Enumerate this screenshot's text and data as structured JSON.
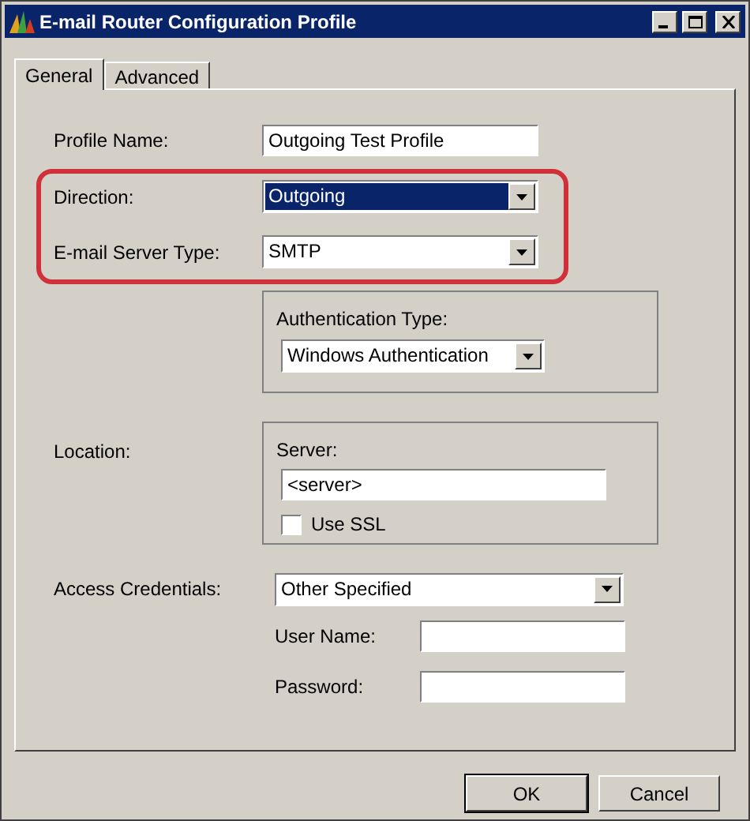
{
  "window": {
    "title": "E-mail Router Configuration Profile"
  },
  "tabs": [
    {
      "label": "General",
      "selected": true
    },
    {
      "label": "Advanced",
      "selected": false
    }
  ],
  "profile_name": {
    "label": "Profile Name:",
    "value": "Outgoing Test Profile"
  },
  "direction": {
    "label": "Direction:",
    "value": "Outgoing",
    "focused": true
  },
  "server_type": {
    "label": "E-mail Server Type:",
    "value": "SMTP",
    "focused": false
  },
  "authentication": {
    "label": "Authentication Type:",
    "value": "Windows Authentication"
  },
  "location": {
    "label": "Location:",
    "server_label": "Server:",
    "server_value": "<server>",
    "use_ssl": {
      "label": "Use SSL",
      "checked": false
    }
  },
  "access_credentials": {
    "label": "Access Credentials:",
    "value": "Other Specified"
  },
  "user_name": {
    "label": "User Name:"
  },
  "password": {
    "label": "Password:"
  },
  "buttons": [
    {
      "label": "OK",
      "default": true
    },
    {
      "label": "Cancel",
      "default": false
    }
  ]
}
